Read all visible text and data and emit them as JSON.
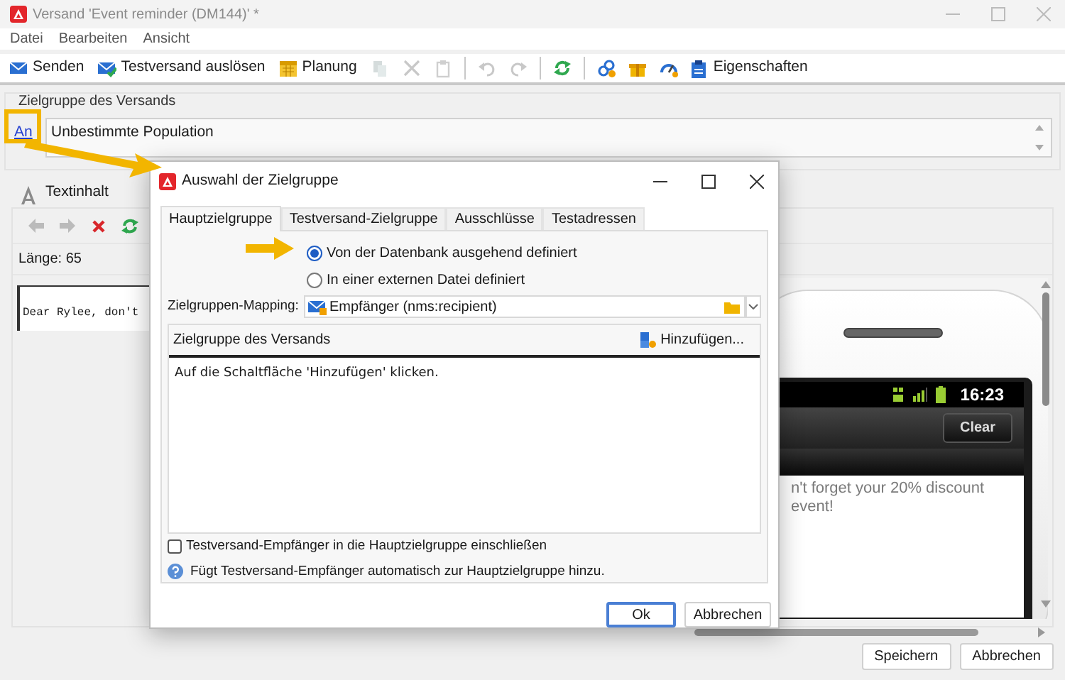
{
  "window": {
    "title": "Versand 'Event reminder (DM144)' *"
  },
  "menu": [
    "Datei",
    "Bearbeiten",
    "Ansicht"
  ],
  "toolbar": [
    {
      "kind": "button",
      "label": "Senden"
    },
    {
      "kind": "button",
      "label": "Testversand auslösen"
    },
    {
      "kind": "button",
      "label": "Planung"
    },
    {
      "kind": "icon",
      "disabled": true
    },
    {
      "kind": "icon",
      "disabled": true
    },
    {
      "kind": "icon",
      "disabled": true
    },
    {
      "kind": "separator"
    },
    {
      "kind": "icon",
      "disabled": true
    },
    {
      "kind": "icon",
      "disabled": true
    },
    {
      "kind": "separator"
    },
    {
      "kind": "icon",
      "disabled": false
    },
    {
      "kind": "separator"
    },
    {
      "kind": "icon",
      "disabled": false
    },
    {
      "kind": "icon",
      "disabled": false
    },
    {
      "kind": "icon",
      "disabled": false
    },
    {
      "kind": "button",
      "label": "Eigenschaften"
    }
  ],
  "target": {
    "label": "Zielgruppe des Versands",
    "link": "An",
    "value": "Unbestimmte Population"
  },
  "content": {
    "tab_label": "Textinhalt",
    "editor_toolbar": [
      {
        "disabled": true
      },
      {
        "disabled": true
      },
      {
        "disabled": false
      },
      {
        "disabled": false
      }
    ],
    "length": "Länge: 65",
    "text": "Dear Rylee, don't"
  },
  "preview": {
    "time": "16:23",
    "button": "Clear",
    "message_lines": [
      "n't forget your 20% discount",
      "event!"
    ]
  },
  "footer_buttons": [
    "Speichern",
    "Abbrechen"
  ],
  "dialog": {
    "title": "Auswahl der Zielgruppe",
    "tabs": [
      {
        "label": "Hauptzielgruppe",
        "selected": true
      },
      {
        "label": "Testversand-Zielgruppe",
        "selected": false
      },
      {
        "label": "Ausschlüsse",
        "selected": false
      },
      {
        "label": "Testadressen",
        "selected": false
      }
    ],
    "radios": [
      {
        "label": "Von der Datenbank ausgehend definiert",
        "selected": true
      },
      {
        "label": "In einer externen Datei definiert",
        "selected": false
      }
    ],
    "mapping": {
      "label": "Zielgruppen-Mapping:",
      "value": "Empfänger (nms:recipient)"
    },
    "list": {
      "title": "Zielgruppe des Versands",
      "add_button": "Hinzufügen...",
      "hint": "Auf die Schaltfläche 'Hinzufügen' klicken."
    },
    "checkbox": {
      "label": "Testversand-Empfänger in die Hauptzielgruppe einschließen",
      "checked": false
    },
    "info": "Fügt Testversand-Empfänger automatisch zur Hauptzielgruppe hinzu.",
    "buttons": [
      "Ok",
      "Abbrechen"
    ]
  }
}
